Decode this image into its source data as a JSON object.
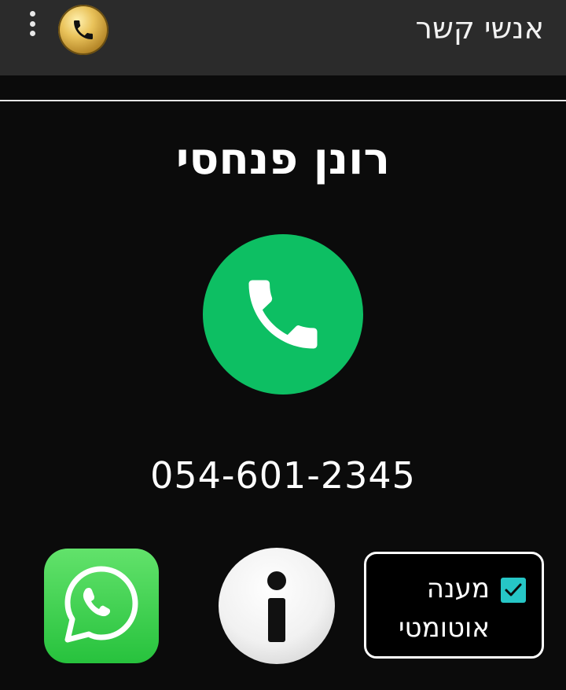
{
  "appbar": {
    "title": "אנשי קשר",
    "menu_icon": "more-vert-icon",
    "logo_icon": "gold-phone-logo-icon"
  },
  "contact": {
    "name": "רונן פנחסי",
    "phone": "054-601-2345"
  },
  "actions": {
    "call_icon": "phone-icon",
    "whatsapp_icon": "whatsapp-icon",
    "info_icon": "info-icon"
  },
  "auto_answer": {
    "label_line1": "מענה",
    "label_line2": "אוטומטי",
    "checked": true
  },
  "colors": {
    "call_green": "#0dbf63",
    "whatsapp_green": "#27c23d",
    "checkbox_teal": "#26c6c6",
    "appbar_bg": "#2b2b2b",
    "background": "#0b0b0b"
  }
}
